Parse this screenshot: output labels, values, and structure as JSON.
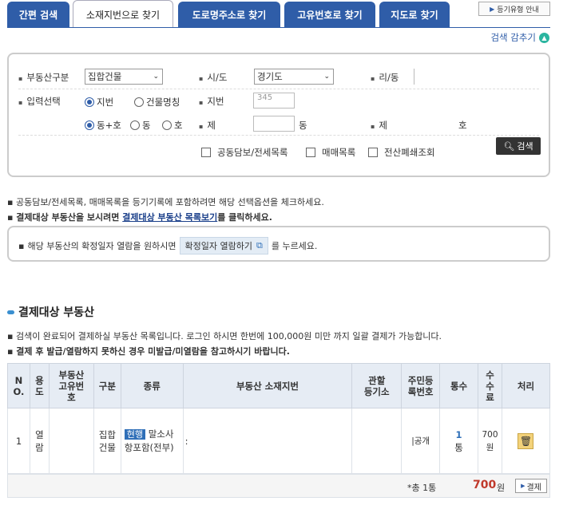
{
  "tabs": [
    {
      "label": "간편 검색"
    },
    {
      "label": "소재지번으로 찾기"
    },
    {
      "label": "도로명주소로 찾기"
    },
    {
      "label": "고유번호로 찾기"
    },
    {
      "label": "지도로 찾기"
    }
  ],
  "guide_label": "등기유형 안내",
  "collapse_label": "검색 감추기",
  "form": {
    "property_type_label": "부동산구분",
    "property_type_value": "집합건물",
    "sido_label": "시/도",
    "sido_value": "경기도",
    "ri_label": "리/동",
    "input_select_label": "입력선택",
    "radio_jibun": "지번",
    "radio_building": "건물명칭",
    "jibun_label": "지번",
    "jibun_value": "345",
    "radio_dongho": "동+호",
    "radio_dong": "동",
    "radio_ho": "호",
    "je_label": "제",
    "dong_suffix": "동",
    "je2_label": "제",
    "ho_suffix": "호",
    "chk_collateral": "공동담보/전세목록",
    "chk_trade": "매매목록",
    "chk_closed": "전산폐쇄조회",
    "search_button": "검색"
  },
  "notes": {
    "n1": "공동담보/전세목록, 매매목록을 등기기록에 포함하려면 해당 선택옵션을 체크하세요.",
    "n2_pre": "결제대상 부동산을 보시려면",
    "n2_link": "결제대상 부동산 목록보기",
    "n2_post": "를 클릭하세요.",
    "info_pre": "해당 부동산의 확정일자 열람을 원하시면",
    "info_btn": "확정일자 열람하기",
    "info_post": "를 누르세요."
  },
  "section": {
    "title": "결제대상 부동산",
    "desc1": "검색이 완료되어 결제하실 부동산 목록입니다. 로그인 하시면 한번에 100,000원 미만 까지 일괄 결제가 가능합니다.",
    "desc2": "결제 후 발급/열람하지 못하신 경우 미발급/미열람을 참고하시기 바랍니다."
  },
  "table": {
    "headers": [
      "N\nO.",
      "용\n도",
      "부동산\n고유번\n호",
      "구분",
      "종류",
      "부동산 소재지번",
      "관할\n등기소",
      "주민등\n록번호",
      "통수",
      "수\n수\n료",
      "처리"
    ],
    "row": {
      "no": "1",
      "use": "열\n람",
      "unique_no": "",
      "category": "집합\n건물",
      "badge": "현행",
      "kind": "말소사\n항포함(전부)",
      "address": ":",
      "registry": "",
      "resident_no": "|공개",
      "count": "1",
      "count_unit": "통",
      "fee": "700\n원"
    },
    "total_label": "*총 1통",
    "total_amount": "700",
    "total_unit": "원",
    "pay_button": "결제"
  }
}
